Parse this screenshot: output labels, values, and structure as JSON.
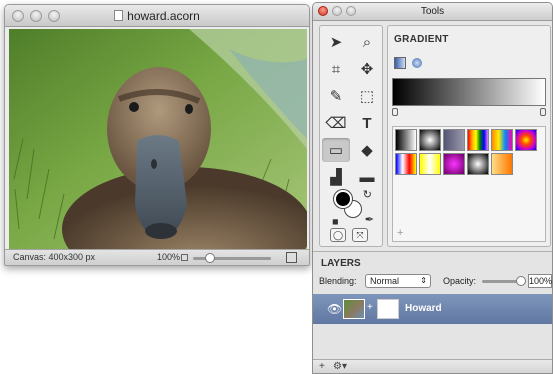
{
  "image_window": {
    "title": "howard.acorn",
    "status_canvas": "Canvas: 400x300 px",
    "zoom": "100%"
  },
  "tools_window": {
    "title": "Tools",
    "gradient_panel": {
      "title": "GRADIENT",
      "add_preset": "+"
    },
    "layers": {
      "title": "LAYERS",
      "blending_label": "Blending:",
      "blending_value": "Normal",
      "opacity_label": "Opacity:",
      "opacity_value": "100%",
      "layer_name": "Howard",
      "footer_add": "+",
      "footer_gear": "⚙▾"
    }
  },
  "tools": [
    {
      "icon": "select-arrow-icon",
      "glyph": "➤"
    },
    {
      "icon": "zoom-icon",
      "glyph": "🔍"
    },
    {
      "icon": "crop-icon",
      "glyph": "⌗"
    },
    {
      "icon": "move-icon",
      "glyph": "✥"
    },
    {
      "icon": "brush-icon",
      "glyph": "🖌"
    },
    {
      "icon": "marquee-icon",
      "glyph": "⬚"
    },
    {
      "icon": "eraser-icon",
      "glyph": "✏"
    },
    {
      "icon": "text-icon",
      "glyph": "T"
    },
    {
      "icon": "gradient-tool-icon",
      "glyph": "▭"
    },
    {
      "icon": "bucket-icon",
      "glyph": "⬙"
    },
    {
      "icon": "clone-icon",
      "glyph": "▟"
    },
    {
      "icon": "shape-icon",
      "glyph": "▬"
    }
  ],
  "colors": {
    "accent": "#5f78a2",
    "foreground": "#000000",
    "background": "#ffffff"
  }
}
